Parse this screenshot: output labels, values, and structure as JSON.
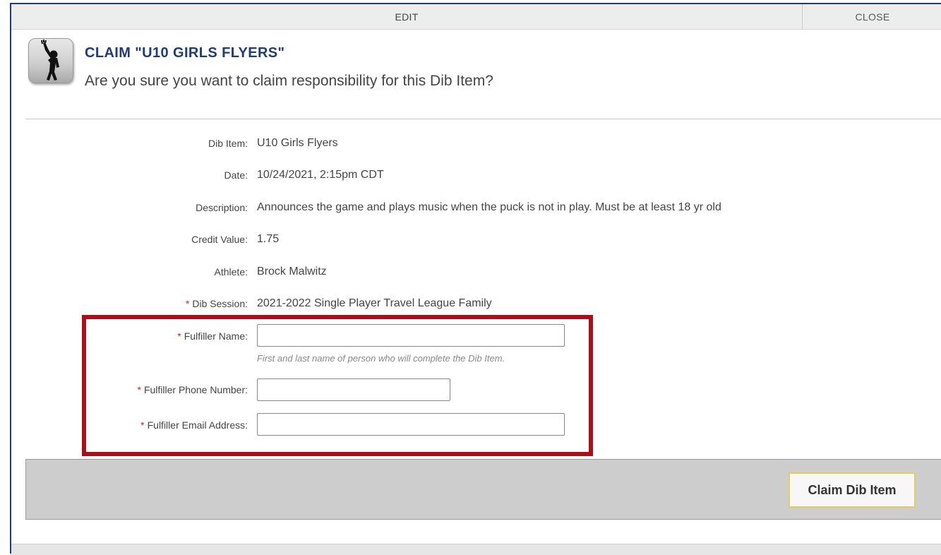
{
  "topbar": {
    "edit_label": "EDIT",
    "close_label": "CLOSE"
  },
  "header": {
    "icon": "waving-person-icon",
    "title": "CLAIM \"U10 GIRLS FLYERS\"",
    "subtitle": "Are you sure you want to claim responsibility for this Dib Item?"
  },
  "details": [
    {
      "label": "Dib Item:",
      "value": "U10 Girls Flyers",
      "required": false
    },
    {
      "label": "Date:",
      "value": "10/24/2021, 2:15pm CDT",
      "required": false
    },
    {
      "label": "Description:",
      "value": "Announces the game and plays music when the puck is not in play. Must be at least 18 yr old",
      "required": false
    },
    {
      "label": "Credit Value:",
      "value": "1.75",
      "required": false
    },
    {
      "label": "Athlete:",
      "value": "Brock Malwitz",
      "required": false
    },
    {
      "label": "Dib Session:",
      "value": "2021-2022 Single Player Travel League Family",
      "required": true
    }
  ],
  "form": {
    "required_marker": "*",
    "fulfiller_name": {
      "label": "Fulfiller Name:",
      "value": "",
      "hint": "First and last name of person who will complete the Dib Item."
    },
    "fulfiller_phone": {
      "label": "Fulfiller Phone Number:",
      "value": ""
    },
    "fulfiller_email": {
      "label": "Fulfiller Email Address:",
      "value": ""
    }
  },
  "footer": {
    "claim_label": "Claim Dib Item"
  },
  "colors": {
    "title": "#1f3b78",
    "required": "#dd2222",
    "highlight": "#a8101a",
    "button_border": "#e2cc5c"
  }
}
